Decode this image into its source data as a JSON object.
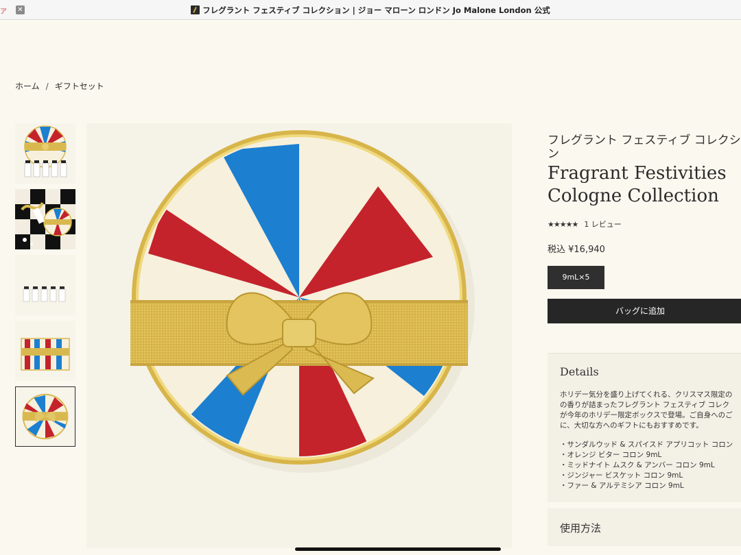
{
  "browser": {
    "tab_title": "フレグラント フェスティブ コレクション | ジョー マローン ロンドン Jo Malone London 公式",
    "close_label": "✕",
    "edge_tab_label": "ア"
  },
  "breadcrumb": {
    "home": "ホーム",
    "separator": "/",
    "current": "ギフトセット"
  },
  "thumbnails": [
    {
      "name": "gift-box-with-bottles",
      "active": false
    },
    {
      "name": "lifestyle-box-with-ornaments",
      "active": false
    },
    {
      "name": "five-cologne-bottles",
      "active": false
    },
    {
      "name": "striped-box-side",
      "active": false
    },
    {
      "name": "gift-box-top",
      "active": true
    }
  ],
  "product": {
    "jp_title_line1": "フレグラント フェスティブ コレクショ",
    "jp_title_line2": "ン",
    "en_title_line1": "Fragrant Festivities",
    "en_title_line2": "Cologne Collection",
    "stars": "★★★★★",
    "review_count": "1 レビュー",
    "price": "税込 ¥16,940",
    "size_option": "9mL×5",
    "add_to_bag": "バッグに追加"
  },
  "details": {
    "heading": "Details",
    "desc_lines": [
      "ホリデー気分を盛り上げてくれる、クリスマス限定の",
      "の香りが詰まったフレグラント フェスティブ コレク",
      "が今年のホリデー限定ボックスで登場。ご自身へのご",
      "に、大切な方へのギフトにもおすすめです。"
    ],
    "items": [
      "・サンダルウッド & スパイスド アプリコット コロン",
      "・オレンジ ビター コロン 9mL",
      "・ミッドナイト ムスク & アンバー コロン 9mL",
      "・ジンジャー ビスケット コロン 9mL",
      "・ファー & アルテミシア コロン 9mL"
    ]
  },
  "usage": {
    "heading": "使用方法"
  },
  "colors": {
    "background": "#fbf8ef",
    "red": "#c4232b",
    "blue": "#1c7fd0",
    "cream": "#f6f0dd",
    "gold": "#d9b94f",
    "button_dark": "#262626"
  }
}
